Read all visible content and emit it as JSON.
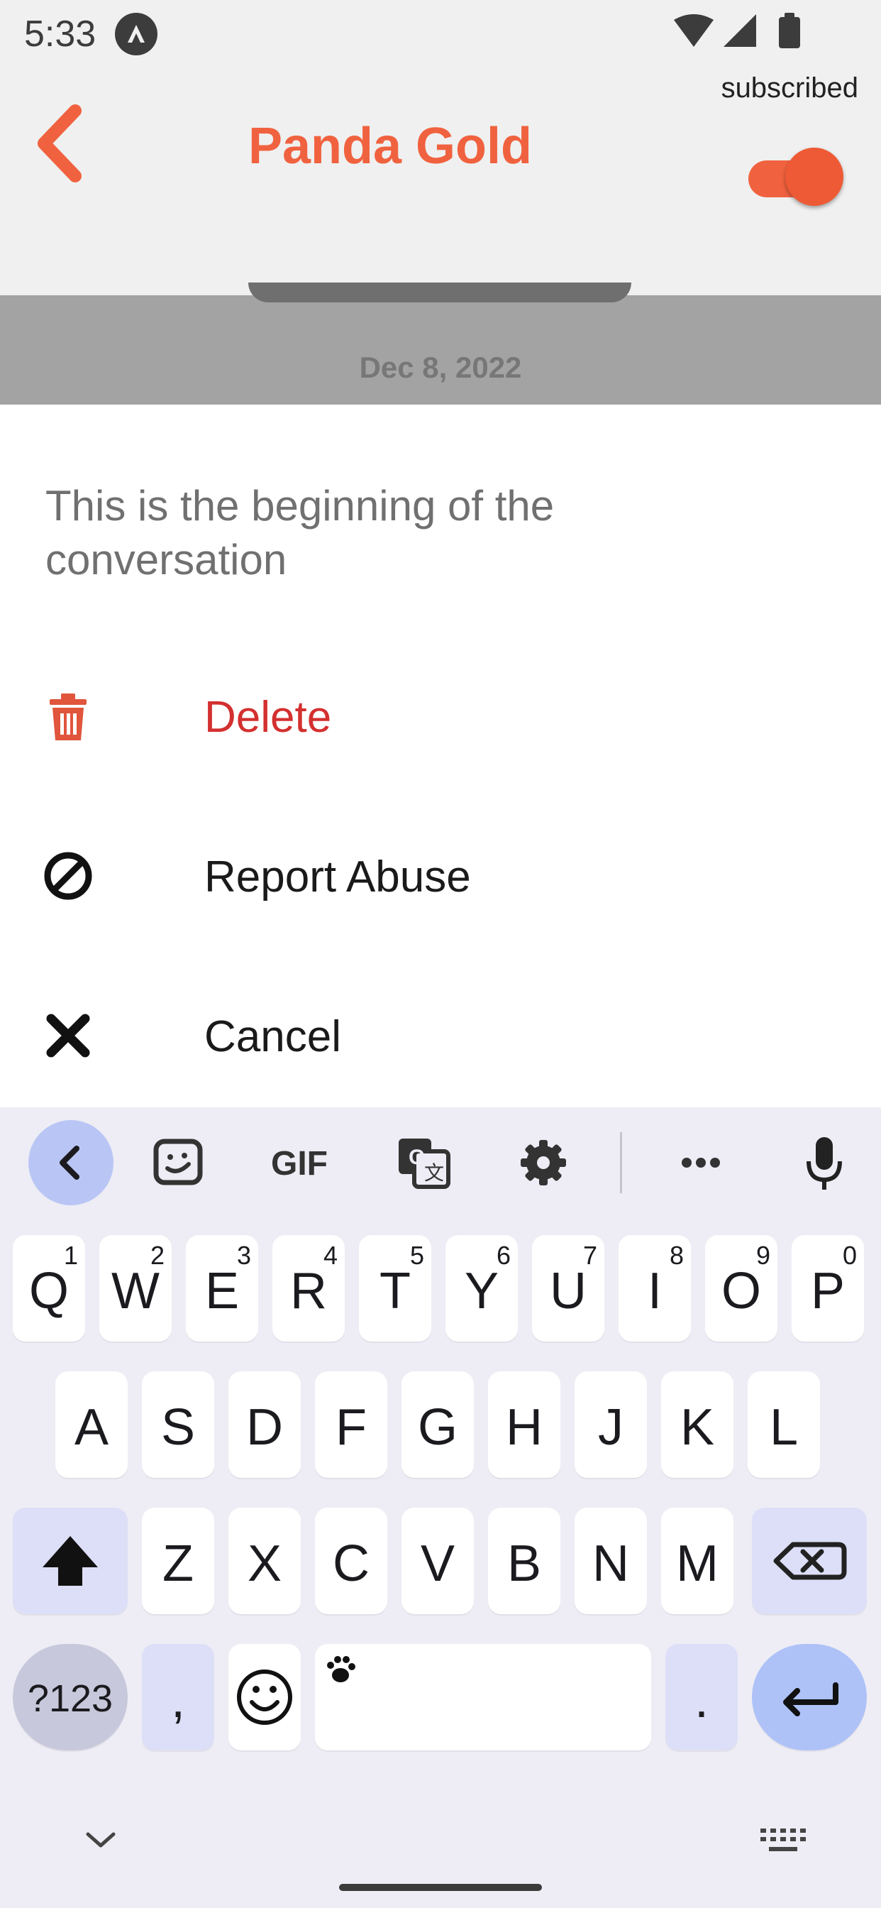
{
  "status_bar": {
    "time": "5:33",
    "notification_icon": "app-logo-icon",
    "icons": [
      "wifi-icon",
      "cellular-signal-icon",
      "battery-icon"
    ]
  },
  "header": {
    "title": "Panda Gold",
    "back_icon": "chevron-left-icon",
    "subscribed_label": "subscribed",
    "subscribed_on": true,
    "accent_color": "#f0623f"
  },
  "chat": {
    "date_separator": "Dec 8, 2022"
  },
  "action_sheet": {
    "title": "This is the beginning of the conversation",
    "items": [
      {
        "label": "Delete",
        "icon": "trash-icon",
        "color": "#d3302f"
      },
      {
        "label": "Report Abuse",
        "icon": "block-icon",
        "color": "#1a1a1a"
      },
      {
        "label": "Cancel",
        "icon": "close-icon",
        "color": "#1a1a1a"
      }
    ]
  },
  "keyboard": {
    "toolbar": [
      "chevron-left-icon",
      "sticker-icon",
      "gif-icon",
      "translate-icon",
      "gear-icon",
      "more-icon",
      "mic-icon"
    ],
    "gif_label": "GIF",
    "row1": [
      {
        "ch": "Q",
        "sup": "1"
      },
      {
        "ch": "W",
        "sup": "2"
      },
      {
        "ch": "E",
        "sup": "3"
      },
      {
        "ch": "R",
        "sup": "4"
      },
      {
        "ch": "T",
        "sup": "5"
      },
      {
        "ch": "Y",
        "sup": "6"
      },
      {
        "ch": "U",
        "sup": "7"
      },
      {
        "ch": "I",
        "sup": "8"
      },
      {
        "ch": "O",
        "sup": "9"
      },
      {
        "ch": "P",
        "sup": "0"
      }
    ],
    "row2": [
      "A",
      "S",
      "D",
      "F",
      "G",
      "H",
      "J",
      "K",
      "L"
    ],
    "row3": [
      "Z",
      "X",
      "C",
      "V",
      "B",
      "N",
      "M"
    ],
    "symbols_label": "?123",
    "comma_label": ",",
    "period_label": ".",
    "shift_icon": "shift-icon",
    "backspace_icon": "backspace-icon",
    "emoji_icon": "emoji-icon",
    "enter_icon": "enter-icon",
    "space_icon": "paw-icon"
  }
}
